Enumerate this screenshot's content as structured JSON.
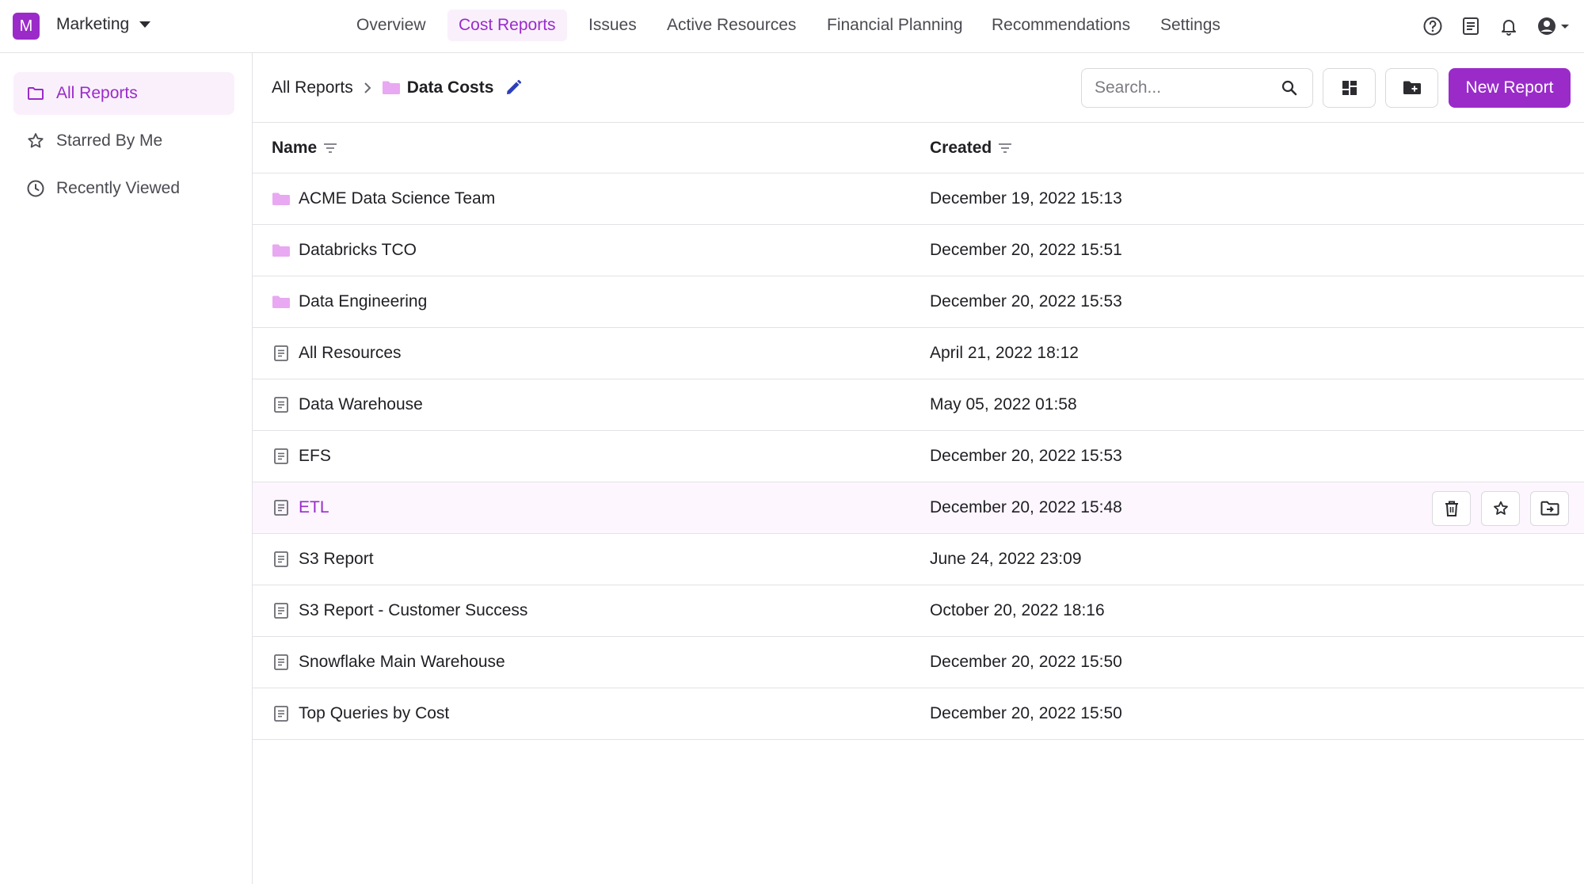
{
  "workspace": {
    "initial": "M",
    "name": "Marketing"
  },
  "nav": {
    "overview": "Overview",
    "cost_reports": "Cost Reports",
    "issues": "Issues",
    "active_resources": "Active Resources",
    "financial_planning": "Financial Planning",
    "recommendations": "Recommendations",
    "settings": "Settings",
    "active": "Cost Reports"
  },
  "top_icons": [
    "help-icon",
    "docs-icon",
    "bell-icon",
    "account-icon"
  ],
  "sidebar": {
    "all_reports": "All Reports",
    "starred": "Starred By Me",
    "recent": "Recently Viewed",
    "active": "All Reports"
  },
  "breadcrumb": {
    "root": "All Reports",
    "current": "Data Costs"
  },
  "search": {
    "placeholder": "Search..."
  },
  "toolbar": {
    "new_report": "New Report"
  },
  "table": {
    "headers": {
      "name": "Name",
      "created": "Created"
    },
    "rows": [
      {
        "type": "folder",
        "name": "ACME Data Science Team",
        "created": "December 19, 2022 15:13"
      },
      {
        "type": "folder",
        "name": "Databricks TCO",
        "created": "December 20, 2022 15:51"
      },
      {
        "type": "folder",
        "name": "Data Engineering",
        "created": "December 20, 2022 15:53"
      },
      {
        "type": "report",
        "name": "All Resources",
        "created": "April 21, 2022 18:12"
      },
      {
        "type": "report",
        "name": "Data Warehouse",
        "created": "May 05, 2022 01:58"
      },
      {
        "type": "report",
        "name": "EFS",
        "created": "December 20, 2022 15:53"
      },
      {
        "type": "report",
        "name": "ETL",
        "created": "December 20, 2022 15:48"
      },
      {
        "type": "report",
        "name": "S3 Report",
        "created": "June 24, 2022 23:09"
      },
      {
        "type": "report",
        "name": "S3 Report - Customer Success",
        "created": "October 20, 2022 18:16"
      },
      {
        "type": "report",
        "name": "Snowflake Main Warehouse",
        "created": "December 20, 2022 15:50"
      },
      {
        "type": "report",
        "name": "Top Queries by Cost",
        "created": "December 20, 2022 15:50"
      }
    ],
    "hovered_row": "ETL"
  },
  "colors": {
    "accent": "#9a2bc9",
    "accent_bg": "#faf0fc",
    "folder": "#e9a8f2",
    "border": "#e2e2e6"
  }
}
